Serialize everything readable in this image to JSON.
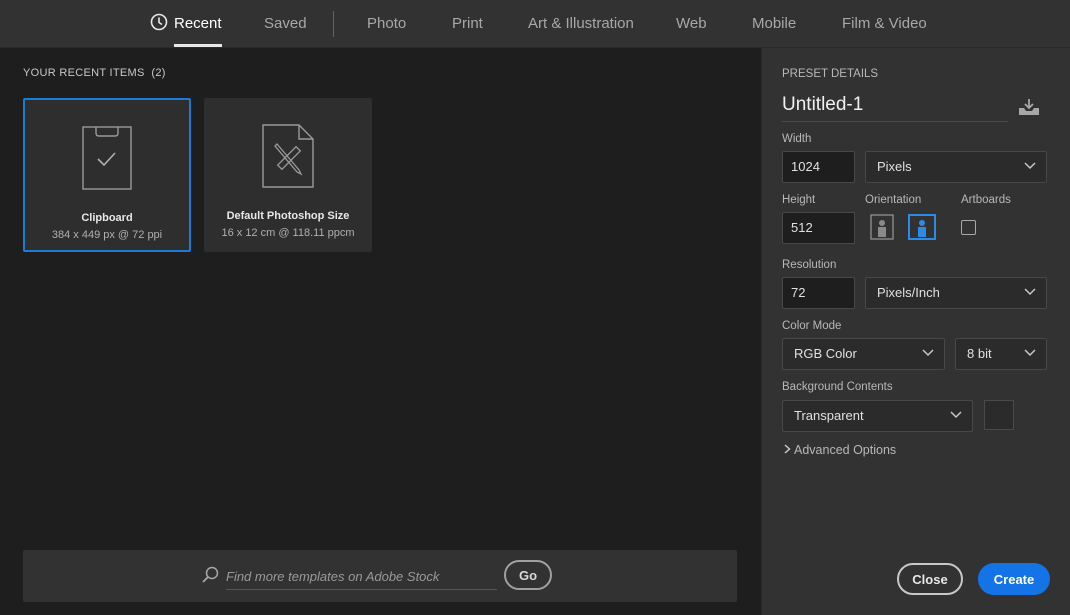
{
  "nav": {
    "tabs": [
      {
        "label": "Recent",
        "active": true
      },
      {
        "label": "Saved"
      },
      {
        "label": "Photo"
      },
      {
        "label": "Print"
      },
      {
        "label": "Art & Illustration"
      },
      {
        "label": "Web"
      },
      {
        "label": "Mobile"
      },
      {
        "label": "Film & Video"
      }
    ]
  },
  "recent": {
    "title": "YOUR RECENT ITEMS",
    "count": "(2)",
    "items": [
      {
        "name": "Clipboard",
        "meta": "384 x 449 px @ 72 ppi",
        "icon": "clipboard-doc-icon",
        "selected": true
      },
      {
        "name": "Default Photoshop Size",
        "meta": "16 x 12 cm @ 118.11 ppcm",
        "icon": "ruler-pencil-doc-icon"
      }
    ]
  },
  "search": {
    "placeholder": "Find more templates on Adobe Stock",
    "go_label": "Go"
  },
  "preset": {
    "heading": "PRESET DETAILS",
    "name": "Untitled-1",
    "width_label": "Width",
    "width_value": "1024",
    "width_unit": "Pixels",
    "height_label": "Height",
    "height_value": "512",
    "orientation_label": "Orientation",
    "orientation_selected": "landscape",
    "artboards_label": "Artboards",
    "resolution_label": "Resolution",
    "resolution_value": "72",
    "resolution_unit": "Pixels/Inch",
    "color_mode_label": "Color Mode",
    "color_mode": "RGB Color",
    "bit_depth": "8 bit",
    "background_label": "Background Contents",
    "background": "Transparent",
    "advanced_label": "Advanced Options",
    "close_label": "Close",
    "create_label": "Create"
  },
  "colors": {
    "accent": "#1b7bd6",
    "create_button": "#1473e6"
  }
}
